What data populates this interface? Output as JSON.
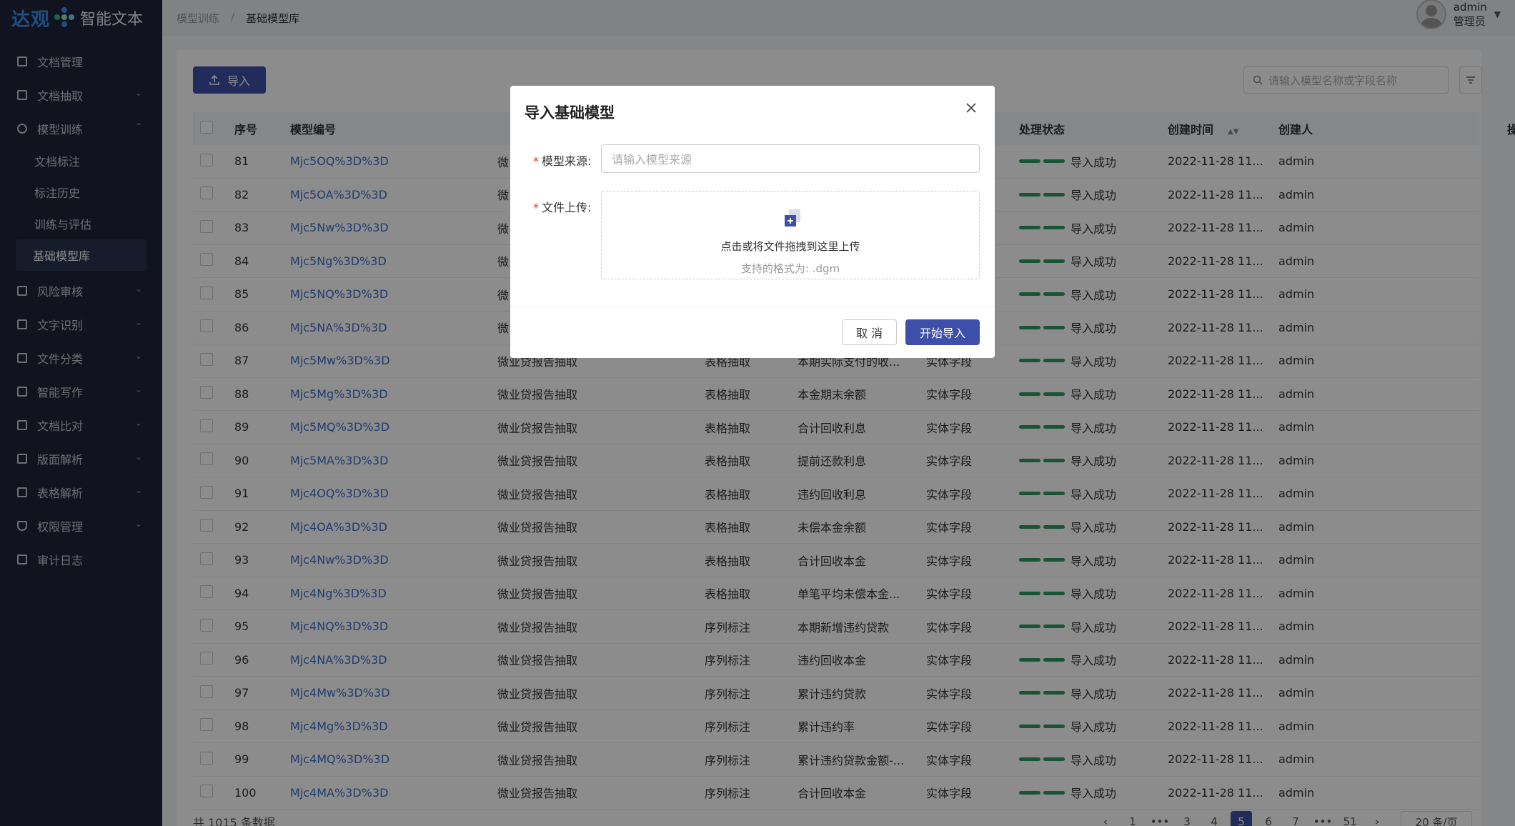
{
  "app": {
    "logo_brand": "达观",
    "logo_name": "智能文本"
  },
  "sidebar": {
    "items": [
      {
        "label": "文档管理"
      },
      {
        "label": "文档抽取"
      },
      {
        "label": "模型训练"
      },
      {
        "label": "风险审核"
      },
      {
        "label": "文字识别"
      },
      {
        "label": "文件分类"
      },
      {
        "label": "智能写作"
      },
      {
        "label": "文档比对"
      },
      {
        "label": "版面解析"
      },
      {
        "label": "表格解析"
      },
      {
        "label": "权限管理"
      },
      {
        "label": "审计日志"
      }
    ],
    "sub_items": [
      {
        "label": "文档标注"
      },
      {
        "label": "标注历史"
      },
      {
        "label": "训练与评估"
      },
      {
        "label": "基础模型库"
      }
    ]
  },
  "breadcrumb": {
    "parent": "模型训练",
    "sep": "/",
    "current": "基础模型库"
  },
  "user": {
    "name": "admin",
    "role": "管理员"
  },
  "toolbar": {
    "import_label": "导入",
    "search_placeholder": "请输入模型名称或字段名称"
  },
  "table": {
    "headers": {
      "index": "序号",
      "code": "模型编号",
      "status": "处理状态",
      "time": "创建时间",
      "creator": "创建人",
      "ops": "操作"
    },
    "rows": [
      {
        "idx": "81",
        "code": "Mjc5OQ%3D%3D",
        "cat": "微",
        "method": "",
        "name": "",
        "type": "",
        "status": "导入成功",
        "time": "2022-11-28 11...",
        "creator": "admin"
      },
      {
        "idx": "82",
        "code": "Mjc5OA%3D%3D",
        "cat": "微",
        "method": "",
        "name": "",
        "type": "",
        "status": "导入成功",
        "time": "2022-11-28 11...",
        "creator": "admin"
      },
      {
        "idx": "83",
        "code": "Mjc5Nw%3D%3D",
        "cat": "微",
        "method": "",
        "name": "",
        "type": "",
        "status": "导入成功",
        "time": "2022-11-28 11...",
        "creator": "admin"
      },
      {
        "idx": "84",
        "code": "Mjc5Ng%3D%3D",
        "cat": "微",
        "method": "",
        "name": "",
        "type": "",
        "status": "导入成功",
        "time": "2022-11-28 11...",
        "creator": "admin"
      },
      {
        "idx": "85",
        "code": "Mjc5NQ%3D%3D",
        "cat": "微",
        "method": "",
        "name": "",
        "type": "",
        "status": "导入成功",
        "time": "2022-11-28 11...",
        "creator": "admin"
      },
      {
        "idx": "86",
        "code": "Mjc5NA%3D%3D",
        "cat": "微",
        "method": "",
        "name": "",
        "type": "",
        "status": "导入成功",
        "time": "2022-11-28 11...",
        "creator": "admin"
      },
      {
        "idx": "87",
        "code": "Mjc5Mw%3D%3D",
        "cat": "微业贷报告抽取",
        "method": "表格抽取",
        "name": "本期实际支付的收...",
        "type": "实体字段",
        "status": "导入成功",
        "time": "2022-11-28 11...",
        "creator": "admin"
      },
      {
        "idx": "88",
        "code": "Mjc5Mg%3D%3D",
        "cat": "微业贷报告抽取",
        "method": "表格抽取",
        "name": "本金期末余额",
        "type": "实体字段",
        "status": "导入成功",
        "time": "2022-11-28 11...",
        "creator": "admin"
      },
      {
        "idx": "89",
        "code": "Mjc5MQ%3D%3D",
        "cat": "微业贷报告抽取",
        "method": "表格抽取",
        "name": "合计回收利息",
        "type": "实体字段",
        "status": "导入成功",
        "time": "2022-11-28 11...",
        "creator": "admin"
      },
      {
        "idx": "90",
        "code": "Mjc5MA%3D%3D",
        "cat": "微业贷报告抽取",
        "method": "表格抽取",
        "name": "提前还款利息",
        "type": "实体字段",
        "status": "导入成功",
        "time": "2022-11-28 11...",
        "creator": "admin"
      },
      {
        "idx": "91",
        "code": "Mjc4OQ%3D%3D",
        "cat": "微业贷报告抽取",
        "method": "表格抽取",
        "name": "违约回收利息",
        "type": "实体字段",
        "status": "导入成功",
        "time": "2022-11-28 11...",
        "creator": "admin"
      },
      {
        "idx": "92",
        "code": "Mjc4OA%3D%3D",
        "cat": "微业贷报告抽取",
        "method": "表格抽取",
        "name": "未偿本金余额",
        "type": "实体字段",
        "status": "导入成功",
        "time": "2022-11-28 11...",
        "creator": "admin"
      },
      {
        "idx": "93",
        "code": "Mjc4Nw%3D%3D",
        "cat": "微业贷报告抽取",
        "method": "表格抽取",
        "name": "合计回收本金",
        "type": "实体字段",
        "status": "导入成功",
        "time": "2022-11-28 11...",
        "creator": "admin"
      },
      {
        "idx": "94",
        "code": "Mjc4Ng%3D%3D",
        "cat": "微业贷报告抽取",
        "method": "表格抽取",
        "name": "单笔平均未偿本金...",
        "type": "实体字段",
        "status": "导入成功",
        "time": "2022-11-28 11...",
        "creator": "admin"
      },
      {
        "idx": "95",
        "code": "Mjc4NQ%3D%3D",
        "cat": "微业贷报告抽取",
        "method": "序列标注",
        "name": "本期新增违约贷款",
        "type": "实体字段",
        "status": "导入成功",
        "time": "2022-11-28 11...",
        "creator": "admin"
      },
      {
        "idx": "96",
        "code": "Mjc4NA%3D%3D",
        "cat": "微业贷报告抽取",
        "method": "序列标注",
        "name": "违约回收本金",
        "type": "实体字段",
        "status": "导入成功",
        "time": "2022-11-28 11...",
        "creator": "admin"
      },
      {
        "idx": "97",
        "code": "Mjc4Mw%3D%3D",
        "cat": "微业贷报告抽取",
        "method": "序列标注",
        "name": "累计违约贷款",
        "type": "实体字段",
        "status": "导入成功",
        "time": "2022-11-28 11...",
        "creator": "admin"
      },
      {
        "idx": "98",
        "code": "Mjc4Mg%3D%3D",
        "cat": "微业贷报告抽取",
        "method": "序列标注",
        "name": "累计违约率",
        "type": "实体字段",
        "status": "导入成功",
        "time": "2022-11-28 11...",
        "creator": "admin"
      },
      {
        "idx": "99",
        "code": "Mjc4MQ%3D%3D",
        "cat": "微业贷报告抽取",
        "method": "序列标注",
        "name": "累计违约贷款金额-...",
        "type": "实体字段",
        "status": "导入成功",
        "time": "2022-11-28 11...",
        "creator": "admin"
      },
      {
        "idx": "100",
        "code": "Mjc4MA%3D%3D",
        "cat": "微业贷报告抽取",
        "method": "序列标注",
        "name": "合计回收本金",
        "type": "实体字段",
        "status": "导入成功",
        "time": "2022-11-28 11...",
        "creator": "admin"
      }
    ]
  },
  "pagination": {
    "total": "共 1015 条数据",
    "pages": [
      "1",
      "•••",
      "3",
      "4",
      "5",
      "6",
      "7",
      "•••",
      "51"
    ],
    "active": "5",
    "page_size": "20 条/页"
  },
  "modal": {
    "title": "导入基础模型",
    "source_label": "模型来源:",
    "source_placeholder": "请输入模型来源",
    "upload_label": "文件上传:",
    "upload_main": "点击或将文件拖拽到这里上传",
    "upload_sub": "支持的格式为: .dgm",
    "cancel": "取 消",
    "ok": "开始导入"
  },
  "colors": {
    "primary": "#3d4fa8",
    "sidebar_bg": "#1f2337",
    "status_green": "#2e9a60",
    "link": "#3d6ec9"
  }
}
